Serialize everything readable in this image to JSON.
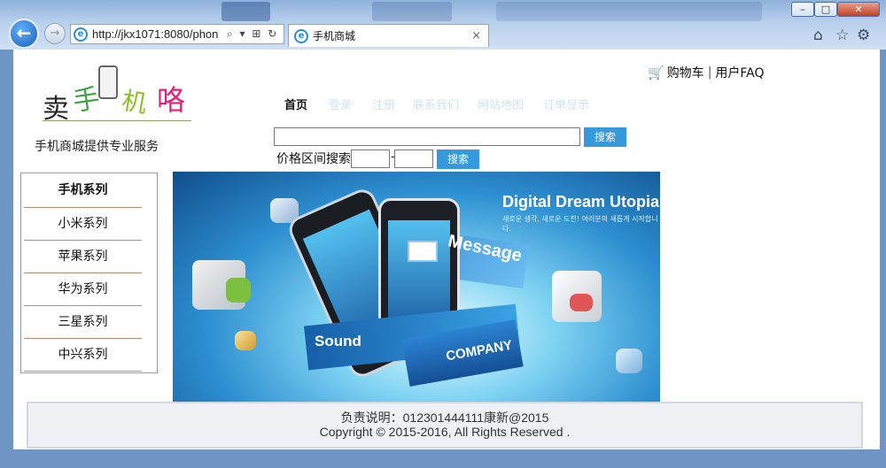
{
  "browser": {
    "back_icon": "back-arrow-icon",
    "forward_icon": "forward-arrow-icon",
    "address_url": "http://jkx1071:8080/phon",
    "address_tools": "⌕ ▾ ⊞ ↻",
    "tab_title": "手机商城",
    "tab_close": "×",
    "window_controls": {
      "minimize": "–",
      "maximize": "□",
      "close": "✕"
    },
    "right_icons": [
      "home-icon",
      "favorites-star-icon",
      "gear-icon"
    ]
  },
  "site": {
    "logo_chars": [
      "卖",
      "手",
      "机",
      "咯"
    ],
    "slogan": "手机商城提供专业服务",
    "cart_label": "购物车",
    "separator": "|",
    "faq_label": "用户FAQ",
    "nav": [
      "首页",
      "登录",
      "注册",
      "联系我们",
      "网站地图",
      "订单显示"
    ],
    "search_value": "",
    "search_button": "搜索",
    "price_label": "价格区间搜索",
    "price_min": "",
    "price_dash": "-",
    "price_max": "",
    "price_button": "搜索"
  },
  "sidebar": {
    "title": "手机系列",
    "items": [
      "小米系列",
      "苹果系列",
      "华为系列",
      "三星系列",
      "中兴系列"
    ]
  },
  "banner": {
    "title": "Digital Dream Utopia",
    "subtitle": "새로운 생각, 새로운 도전! 여러분의 새롭게 시작합니다.",
    "message_text": "Message",
    "sound_text": "Sound",
    "company_text": "COMPANY"
  },
  "footer": {
    "line1": "负责说明：012301444111康新@2015",
    "line2": "Copyright © 2015-2016, All Rights Reserved ."
  },
  "colors": {
    "button_blue": "#3699db",
    "nav_inactive": "#cfe4f3",
    "logo_mai": "#222222",
    "logo_shou": "#43a047",
    "logo_ji": "#8bbf2a",
    "logo_luo": "#e0207a"
  }
}
